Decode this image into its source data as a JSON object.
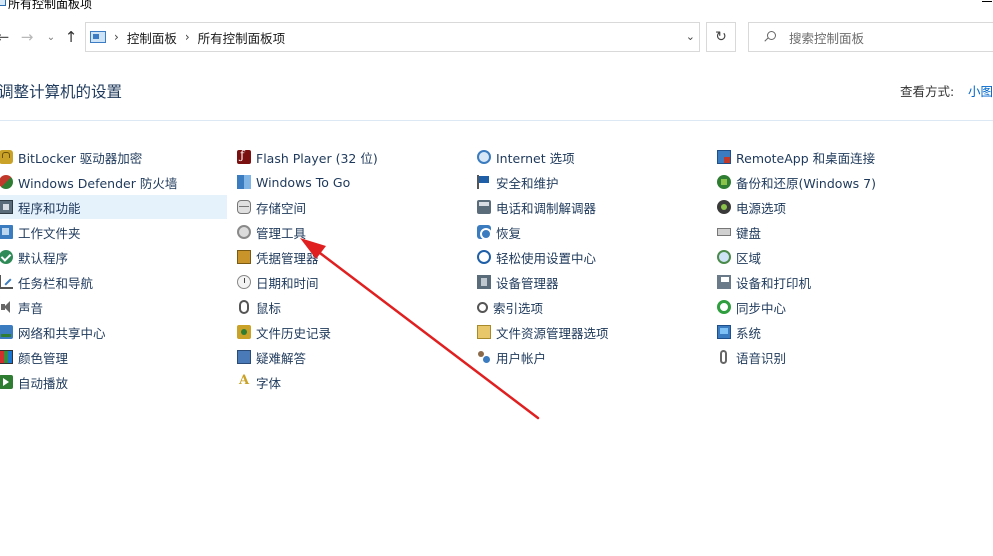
{
  "window": {
    "title": "所有控制面板项"
  },
  "address": {
    "crumbs": [
      "控制面板",
      "所有控制面板项"
    ]
  },
  "search": {
    "placeholder": "搜索控制面板"
  },
  "header": {
    "title": "调整计算机的设置",
    "view_by_label": "查看方式:",
    "view_by_value": "小图标"
  },
  "items": {
    "col1": [
      {
        "label": "BitLocker 驱动器加密",
        "icon": "lock-icon"
      },
      {
        "label": "Windows Defender 防火墙",
        "icon": "firewall-icon"
      },
      {
        "label": "程序和功能",
        "icon": "programs-icon"
      },
      {
        "label": "工作文件夹",
        "icon": "work-folders-icon"
      },
      {
        "label": "默认程序",
        "icon": "default-programs-icon"
      },
      {
        "label": "任务栏和导航",
        "icon": "taskbar-icon"
      },
      {
        "label": "声音",
        "icon": "speaker-icon"
      },
      {
        "label": "网络和共享中心",
        "icon": "network-icon"
      },
      {
        "label": "颜色管理",
        "icon": "color-management-icon"
      },
      {
        "label": "自动播放",
        "icon": "autoplay-icon"
      }
    ],
    "col2": [
      {
        "label": "Flash Player (32 位)",
        "icon": "flash-icon"
      },
      {
        "label": "Windows To Go",
        "icon": "windows-to-go-icon"
      },
      {
        "label": "存储空间",
        "icon": "storage-icon"
      },
      {
        "label": "管理工具",
        "icon": "admin-tools-icon"
      },
      {
        "label": "凭据管理器",
        "icon": "credential-icon"
      },
      {
        "label": "日期和时间",
        "icon": "clock-icon"
      },
      {
        "label": "鼠标",
        "icon": "mouse-icon"
      },
      {
        "label": "文件历史记录",
        "icon": "file-history-icon"
      },
      {
        "label": "疑难解答",
        "icon": "troubleshoot-icon"
      },
      {
        "label": "字体",
        "icon": "font-icon"
      }
    ],
    "col3": [
      {
        "label": "Internet 选项",
        "icon": "globe-icon"
      },
      {
        "label": "安全和维护",
        "icon": "flag-icon"
      },
      {
        "label": "电话和调制解调器",
        "icon": "phone-modem-icon"
      },
      {
        "label": "恢复",
        "icon": "recovery-icon"
      },
      {
        "label": "轻松使用设置中心",
        "icon": "ease-of-access-icon"
      },
      {
        "label": "设备管理器",
        "icon": "device-manager-icon"
      },
      {
        "label": "索引选项",
        "icon": "index-icon"
      },
      {
        "label": "文件资源管理器选项",
        "icon": "explorer-options-icon"
      },
      {
        "label": "用户帐户",
        "icon": "users-icon"
      }
    ],
    "col4": [
      {
        "label": "RemoteApp 和桌面连接",
        "icon": "remoteapp-icon"
      },
      {
        "label": "备份和还原(Windows 7)",
        "icon": "backup-icon"
      },
      {
        "label": "电源选项",
        "icon": "power-icon"
      },
      {
        "label": "键盘",
        "icon": "keyboard-icon"
      },
      {
        "label": "区域",
        "icon": "region-icon"
      },
      {
        "label": "设备和打印机",
        "icon": "printer-icon"
      },
      {
        "label": "同步中心",
        "icon": "sync-icon"
      },
      {
        "label": "系统",
        "icon": "system-icon"
      },
      {
        "label": "语音识别",
        "icon": "microphone-icon"
      }
    ]
  },
  "colors": {
    "link": "#1e395b",
    "view_value": "#0066cc",
    "highlight": "#e5f1fb",
    "arrow": "#e02020"
  }
}
